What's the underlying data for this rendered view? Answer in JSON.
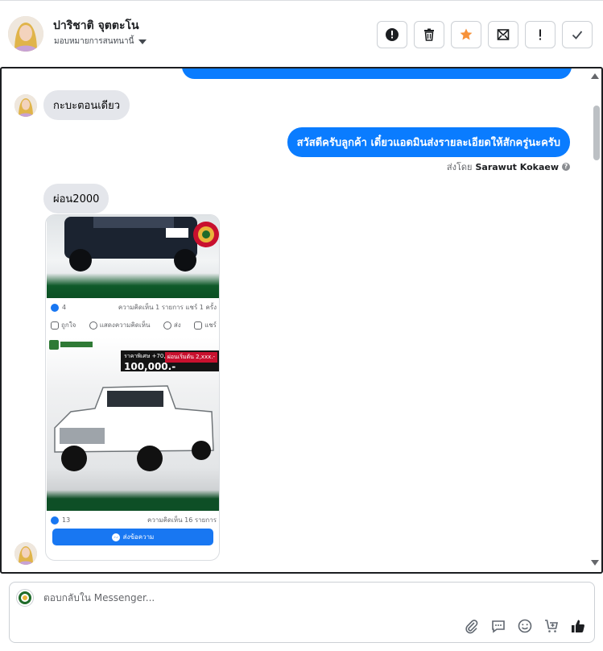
{
  "header": {
    "name": "ปาริชาติ จุตตะโน",
    "assign_label": "มอบหมายการสนทนานี้",
    "actions": [
      {
        "name": "report-button",
        "icon": "alert-circle-icon"
      },
      {
        "name": "delete-button",
        "icon": "trash-icon"
      },
      {
        "name": "star-button",
        "icon": "star-icon"
      },
      {
        "name": "mark-unread-button",
        "icon": "envelope-icon"
      },
      {
        "name": "spam-button",
        "icon": "exclamation-icon"
      },
      {
        "name": "done-button",
        "icon": "check-icon"
      }
    ]
  },
  "messages": {
    "in_1": "กะบะตอนเดียว",
    "out_1": "สวัสดีครับลูกค้า เดี๋ยวแอดมินส่งรายละเอียดให้สักครู่นะครับ",
    "sent_by_prefix": "ส่งโดย",
    "sent_by_name": "Sarawut Kokaew",
    "in_2": "ผ่อน2000"
  },
  "post": {
    "post1_likes": "4",
    "post1_stats_right": "ความคิดเห็น 1 รายการ   แชร์ 1 ครั้ง",
    "action_like": "ถูกใจ",
    "action_comment": "แสดงความคิดเห็น",
    "action_send": "ส่ง",
    "action_share": "แชร์",
    "promo_line": "ราคาพิเศษ +70,000.-",
    "promo_price": "100,000.-",
    "promo_badge": "ผ่อนเริ่มต้น 2,xxx.-",
    "post2_likes": "13",
    "post2_stats_right": "ความคิดเห็น 16 รายการ",
    "send_message_label": "ส่งข้อความ"
  },
  "composer": {
    "placeholder": "ตอบกลับใน Messenger..."
  },
  "colors": {
    "accent_blue": "#0a7cff",
    "star_orange": "#f7923a",
    "incoming_bubble": "#e4e6eb"
  }
}
